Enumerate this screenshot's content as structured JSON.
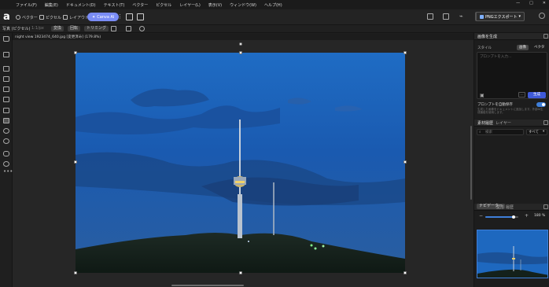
{
  "menu": [
    "ファイル(F)",
    "編集(E)",
    "ドキュメント(D)",
    "テキスト(T)",
    "ベクター",
    "ピクセル",
    "レイヤー(L)",
    "表示(V)",
    "ウィンドウ(W)",
    "ヘルプ(H)"
  ],
  "window_controls": [
    "—",
    "□",
    "✕"
  ],
  "app_logo": "a",
  "toolbar": {
    "vector_label": "ベクター",
    "pixel_label": "ピクセル",
    "layout_label": "レイアウト",
    "canva_ai_label": "Canva AI",
    "export_label": "PNGエクスポート"
  },
  "context_bar": {
    "mode": "写真 (ピクセル)",
    "aspect": "1:1/px",
    "items": [
      "変換",
      "回転",
      "トリミング"
    ]
  },
  "document": {
    "title": "night view 1923474_640.jpg [変更済み] (179.8%)"
  },
  "right_panel": {
    "generative": {
      "title": "画像を生成",
      "style_label": "スタイル",
      "style_options": [
        "画像",
        "ベクター"
      ],
      "prompt_placeholder": "プロンプトを入力...",
      "generate_label": "生成",
      "toggle_label": "プロンプトを自動保存",
      "toggle_desc": "生成した画像をドキュメントに追加します。外部AI生成機能を使用します。"
    },
    "assets": {
      "tabs": [
        "素材履歴",
        "レイヤー"
      ],
      "search_placeholder": "検索",
      "filter_label": "すべて"
    },
    "navigator": {
      "tabs": [
        "ナビゲーター",
        "変形",
        "履歴"
      ],
      "zoom_value": "180 %",
      "zoom_fraction": 0.85
    }
  },
  "colors": {
    "accent": "#3f7fd9",
    "canva_button": "#7a8cf5"
  }
}
